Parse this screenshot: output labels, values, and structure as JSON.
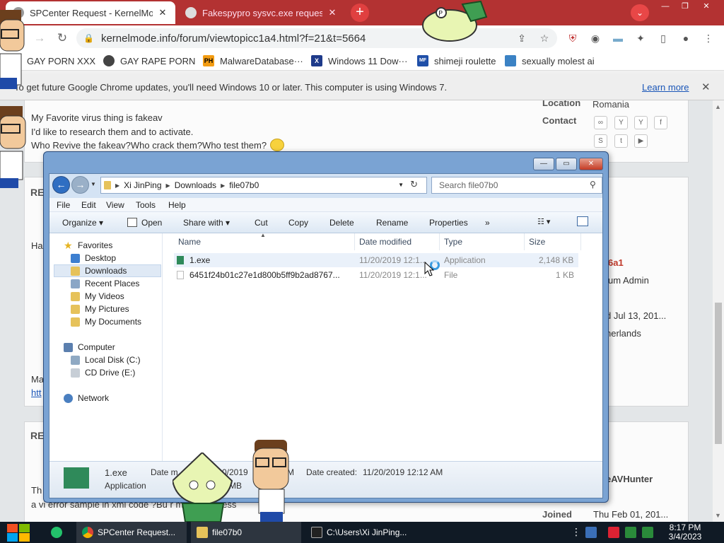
{
  "chrome": {
    "tabs": [
      {
        "title": "SPCenter Request - KernelMod",
        "close": "✕"
      },
      {
        "title": "Fakespypro sysvc.exe reques",
        "close": "✕"
      }
    ],
    "new_tab": "+",
    "tab_search": "⌄",
    "window_controls": {
      "minimize": "—",
      "maximize": "❐",
      "close": "✕"
    },
    "nav": {
      "back": "←",
      "forward": "→",
      "reload": "↻"
    },
    "url": "kernelmode.info/forum/viewtopicc1a4.html?f=21&t=5664",
    "bookmarks": [
      {
        "label": "GAY PORN XXX",
        "icon": "globe-icon"
      },
      {
        "label": "GAY RAPE PORN",
        "icon": "globe-icon"
      },
      {
        "label": "MalwareDatabase···",
        "icon": "ph-icon",
        "badge": "PH"
      },
      {
        "label": "Windows 11 Dow···",
        "icon": "x-icon",
        "badge": "X"
      },
      {
        "label": "shimeji roulette",
        "icon": "mft-icon",
        "badge": "MF"
      },
      {
        "label": "sexually molest ai",
        "icon": "char-icon"
      }
    ],
    "infobar": {
      "message": "To get future Google Chrome updates, you'll need Windows 10 or later. This computer is using Windows 7.",
      "learn_more": "Learn more",
      "close": "✕"
    }
  },
  "forum": {
    "location_label": "Location",
    "location_value": "Romania",
    "contact_label": "Contact",
    "post_lines": [
      "My Favorite virus thing is fakeav",
      "I'd like to research them and to activate.",
      "Who Revive the fakeav?Who crack them?Who test them?"
    ],
    "partial": {
      "re1": "RE",
      "ha": "Ha",
      "ma": "Ma",
      "ht": "htt",
      "re2": "RE",
      "th": "Th",
      "user1": "6a1",
      "role1": "um Admin",
      "joined1": "d Jul 13, 201...",
      "loc1": "herlands",
      "user2": "eAVHunter",
      "bottom_line": "a vi error sample in xml code ?Bu           r malware        ccess",
      "joined_label": "Joined",
      "joined2": "Thu Feb 01, 201..."
    }
  },
  "explorer": {
    "window_buttons": {
      "minimize": "—",
      "maximize": "▭",
      "close": "✕"
    },
    "breadcrumb": [
      "Xi JinPing",
      "Downloads",
      "file07b0"
    ],
    "search_placeholder": "Search file07b0",
    "menu": [
      "File",
      "Edit",
      "View",
      "Tools",
      "Help"
    ],
    "commands": [
      "Organize ▾",
      "Open",
      "Share with ▾",
      "Cut",
      "Copy",
      "Delete",
      "Rename",
      "Properties",
      "»"
    ],
    "nav_pane": {
      "favorites_header": "Favorites",
      "favorites": [
        "Desktop",
        "Downloads",
        "Recent Places",
        "My Videos",
        "My Pictures",
        "My Documents"
      ],
      "computer_header": "Computer",
      "drives": [
        "Local Disk (C:)",
        "CD Drive (E:)"
      ],
      "network": "Network"
    },
    "columns": [
      "Name",
      "Date modified",
      "Type",
      "Size"
    ],
    "files": [
      {
        "name": "1.exe",
        "modified": "11/20/2019 12:1...",
        "type": "Application",
        "size": "2,148 KB"
      },
      {
        "name": "6451f24b01c27e1d800b5ff9b2ad8767...",
        "modified": "11/20/2019 12:1...",
        "type": "File",
        "size": "1 KB"
      }
    ],
    "details_pane": {
      "file_name": "1.exe",
      "file_type": "Application",
      "date_modified_label": "Date m",
      "date_modified_partial": "0/2019",
      "time_partial": "M",
      "date_created_label": "Date created:",
      "date_created": "11/20/2019 12:12 AM",
      "size_partial": "MB"
    }
  },
  "taskbar": {
    "items": [
      {
        "label": "SPCenter Request...",
        "icon": "chrome-icon"
      },
      {
        "label": "file07b0",
        "icon": "folder-icon"
      },
      {
        "label": "C:\\Users\\Xi JinPing...",
        "icon": "cmd-icon"
      }
    ],
    "time": "8:17 PM",
    "date": "3/4/2023"
  },
  "colors": {
    "chrome_tabstrip": "#b33232",
    "forum_bg": "#e3e6e8",
    "explorer_frame": "#7aa3d3",
    "taskbar": "#101a25",
    "link": "#1a56b8"
  }
}
